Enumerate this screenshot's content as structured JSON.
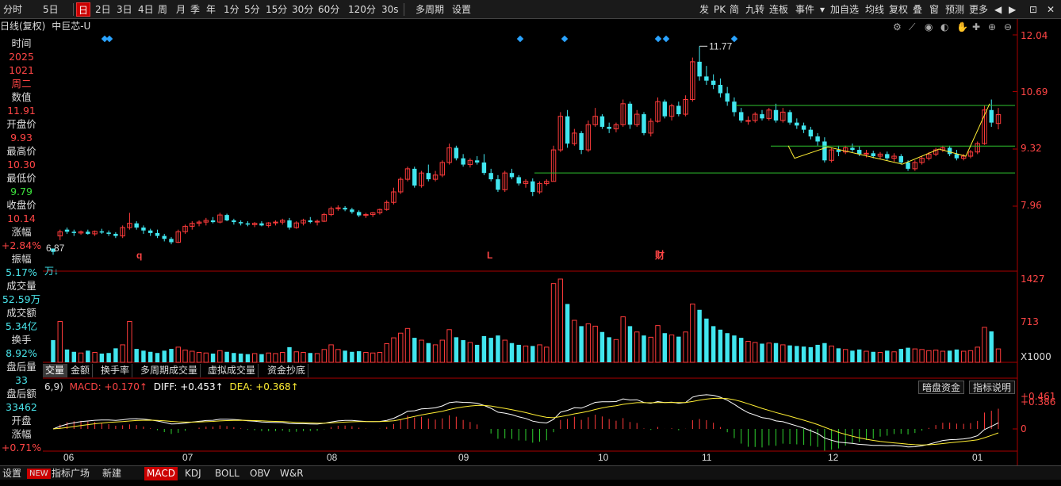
{
  "toolbar": {
    "items": [
      "分时",
      "5日",
      "",
      "日",
      "2日",
      "3日",
      "4日",
      "周",
      "月",
      "季",
      "年",
      "1分",
      "5分",
      "15分",
      "30分",
      "60分",
      "120分",
      "30s",
      "",
      "多周期",
      "设置"
    ],
    "right_items": [
      "发",
      "PK",
      "简",
      "九转",
      "连板",
      "事件",
      "",
      "加自选",
      "均线",
      "复权",
      "叠",
      "窗",
      "预测",
      "更多"
    ]
  },
  "title": {
    "mode": "日线(复权)",
    "stock": "中巨芯-U"
  },
  "left_panel": [
    {
      "label": "时间",
      "value": "2025"
    },
    {
      "label": "",
      "value": "1021"
    },
    {
      "label": "",
      "value": "周二"
    },
    {
      "label": "数值",
      "value": "11.91"
    },
    {
      "label": "开盘价",
      "value": "9.93"
    },
    {
      "label": "最高价",
      "value": "10.30"
    },
    {
      "label": "最低价",
      "value": "9.79"
    },
    {
      "label": "收盘价",
      "value": "10.14"
    },
    {
      "label": "涨幅",
      "value": "+2.84%"
    },
    {
      "label": "振幅",
      "value": "5.17%"
    },
    {
      "label": "成交量",
      "value": "52.59万"
    },
    {
      "label": "成交额",
      "value": "5.34亿"
    },
    {
      "label": "换手",
      "value": "8.92%"
    },
    {
      "label": "盘后量",
      "value": "33"
    },
    {
      "label": "盘后额",
      "value": "33462"
    },
    {
      "label": "开盘",
      "value": ""
    },
    {
      "label": "涨幅",
      "value": "+0.71%"
    }
  ],
  "vol_tabs": [
    "交量",
    "金额",
    "换手率",
    "多周期成交量",
    "虚拟成交量",
    "资金抄底"
  ],
  "macd": {
    "params": "6,9)",
    "macd": "MACD: +0.170↑",
    "diff": "DIFF: +0.453↑",
    "dea": "DEA: +0.368↑",
    "btn1": "暗盘资金",
    "btn2": "指标说明"
  },
  "vol_unit": "万↓",
  "bottom_tabs": [
    "设置",
    "NEW",
    "指标广场",
    "新建",
    "MACD",
    "KDJ",
    "BOLL",
    "OBV",
    "W&R"
  ],
  "chart_data": {
    "type": "candlestick",
    "price_ticks": [
      "12.04",
      "10.69",
      "9.32",
      "7.96"
    ],
    "volume_ticks": [
      "1427",
      "713",
      "X1000"
    ],
    "macd_ticks": [
      "0.461",
      "0.386",
      "0"
    ],
    "x_labels": [
      "06",
      "07",
      "08",
      "09",
      "10",
      "11",
      "12",
      "01"
    ],
    "annotations": {
      "high": "11.77",
      "low": "6.87",
      "markers": [
        "q",
        "L",
        "财"
      ]
    },
    "candles": [
      [
        6.95,
        6.95,
        6.8,
        6.87,
        380
      ],
      [
        7.25,
        7.4,
        7.15,
        7.35,
        700
      ],
      [
        7.4,
        7.45,
        7.3,
        7.35,
        220
      ],
      [
        7.35,
        7.4,
        7.25,
        7.32,
        180
      ],
      [
        7.32,
        7.38,
        7.28,
        7.35,
        160
      ],
      [
        7.35,
        7.4,
        7.28,
        7.3,
        200
      ],
      [
        7.3,
        7.38,
        7.25,
        7.36,
        170
      ],
      [
        7.36,
        7.42,
        7.3,
        7.33,
        150
      ],
      [
        7.33,
        7.38,
        7.25,
        7.3,
        160
      ],
      [
        7.3,
        7.34,
        7.2,
        7.25,
        240
      ],
      [
        7.25,
        7.5,
        7.2,
        7.45,
        300
      ],
      [
        7.45,
        7.8,
        7.4,
        7.55,
        700
      ],
      [
        7.55,
        7.6,
        7.4,
        7.45,
        230
      ],
      [
        7.45,
        7.5,
        7.3,
        7.38,
        200
      ],
      [
        7.38,
        7.42,
        7.25,
        7.32,
        180
      ],
      [
        7.32,
        7.4,
        7.2,
        7.25,
        160
      ],
      [
        7.25,
        7.3,
        7.12,
        7.18,
        200
      ],
      [
        7.18,
        7.22,
        7.05,
        7.1,
        230
      ],
      [
        7.1,
        7.4,
        7.08,
        7.35,
        260
      ],
      [
        7.35,
        7.52,
        7.3,
        7.48,
        210
      ],
      [
        7.48,
        7.6,
        7.4,
        7.55,
        190
      ],
      [
        7.55,
        7.62,
        7.48,
        7.58,
        170
      ],
      [
        7.58,
        7.68,
        7.5,
        7.62,
        160
      ],
      [
        7.62,
        7.7,
        7.55,
        7.58,
        150
      ],
      [
        7.58,
        7.8,
        7.55,
        7.75,
        200
      ],
      [
        7.75,
        7.78,
        7.6,
        7.62,
        180
      ],
      [
        7.62,
        7.66,
        7.52,
        7.58,
        160
      ],
      [
        7.58,
        7.62,
        7.5,
        7.55,
        150
      ],
      [
        7.55,
        7.6,
        7.48,
        7.52,
        140
      ],
      [
        7.52,
        7.58,
        7.46,
        7.55,
        150
      ],
      [
        7.55,
        7.6,
        7.48,
        7.5,
        140
      ],
      [
        7.5,
        7.58,
        7.45,
        7.56,
        160
      ],
      [
        7.56,
        7.62,
        7.5,
        7.58,
        150
      ],
      [
        7.58,
        7.66,
        7.52,
        7.62,
        170
      ],
      [
        7.62,
        7.68,
        7.4,
        7.45,
        260
      ],
      [
        7.45,
        7.6,
        7.42,
        7.56,
        180
      ],
      [
        7.56,
        7.66,
        7.5,
        7.62,
        170
      ],
      [
        7.62,
        7.7,
        7.55,
        7.58,
        160
      ],
      [
        7.58,
        7.64,
        7.5,
        7.6,
        150
      ],
      [
        7.6,
        7.8,
        7.58,
        7.76,
        220
      ],
      [
        7.76,
        7.95,
        7.72,
        7.9,
        300
      ],
      [
        7.9,
        7.98,
        7.85,
        7.92,
        220
      ],
      [
        7.92,
        7.96,
        7.84,
        7.88,
        200
      ],
      [
        7.88,
        7.92,
        7.78,
        7.82,
        180
      ],
      [
        7.82,
        7.86,
        7.7,
        7.74,
        190
      ],
      [
        7.74,
        7.8,
        7.68,
        7.76,
        170
      ],
      [
        7.76,
        7.82,
        7.7,
        7.8,
        160
      ],
      [
        7.8,
        7.9,
        7.76,
        7.88,
        170
      ],
      [
        7.88,
        8.1,
        7.85,
        8.05,
        320
      ],
      [
        8.05,
        8.4,
        8.0,
        8.3,
        420
      ],
      [
        8.3,
        8.65,
        8.25,
        8.6,
        500
      ],
      [
        8.6,
        8.9,
        8.55,
        8.85,
        580
      ],
      [
        8.85,
        8.9,
        8.4,
        8.45,
        420
      ],
      [
        8.45,
        8.8,
        8.4,
        8.75,
        380
      ],
      [
        8.75,
        8.95,
        8.55,
        8.6,
        330
      ],
      [
        8.6,
        8.8,
        8.55,
        8.7,
        300
      ],
      [
        8.7,
        9.05,
        8.65,
        9.0,
        380
      ],
      [
        9.0,
        9.45,
        8.95,
        9.35,
        560
      ],
      [
        9.35,
        9.4,
        9.05,
        9.1,
        430
      ],
      [
        9.1,
        9.2,
        8.9,
        8.95,
        380
      ],
      [
        8.95,
        9.1,
        8.88,
        9.05,
        340
      ],
      [
        9.05,
        9.15,
        8.95,
        9.0,
        300
      ],
      [
        9.0,
        9.2,
        8.7,
        8.75,
        450
      ],
      [
        8.75,
        8.85,
        8.55,
        8.6,
        420
      ],
      [
        8.6,
        8.7,
        8.3,
        8.35,
        460
      ],
      [
        8.35,
        8.8,
        8.3,
        8.75,
        380
      ],
      [
        8.75,
        8.85,
        8.6,
        8.65,
        330
      ],
      [
        8.65,
        8.7,
        8.45,
        8.5,
        300
      ],
      [
        8.5,
        8.6,
        8.4,
        8.55,
        280
      ],
      [
        8.55,
        8.62,
        8.2,
        8.3,
        280
      ],
      [
        8.3,
        8.55,
        8.25,
        8.5,
        300
      ],
      [
        8.5,
        8.6,
        8.45,
        8.55,
        260
      ],
      [
        8.55,
        9.4,
        8.55,
        9.3,
        1350
      ],
      [
        9.3,
        10.2,
        9.25,
        10.1,
        1427
      ],
      [
        10.1,
        10.25,
        9.35,
        9.45,
        1000
      ],
      [
        9.45,
        9.8,
        9.4,
        9.7,
        720
      ],
      [
        9.7,
        9.75,
        9.2,
        9.3,
        620
      ],
      [
        9.3,
        10.0,
        9.25,
        9.9,
        660
      ],
      [
        9.9,
        10.3,
        9.85,
        10.1,
        620
      ],
      [
        10.1,
        10.15,
        9.8,
        9.85,
        520
      ],
      [
        9.85,
        9.95,
        9.7,
        9.8,
        430
      ],
      [
        9.8,
        9.95,
        9.72,
        9.9,
        390
      ],
      [
        9.9,
        10.5,
        9.85,
        10.4,
        780
      ],
      [
        10.4,
        10.45,
        9.8,
        9.9,
        620
      ],
      [
        9.9,
        10.25,
        9.85,
        10.15,
        520
      ],
      [
        10.15,
        10.2,
        9.65,
        9.7,
        460
      ],
      [
        9.7,
        10.05,
        9.62,
        9.98,
        430
      ],
      [
        9.98,
        10.55,
        9.95,
        10.45,
        630
      ],
      [
        10.45,
        10.5,
        10.05,
        10.1,
        500
      ],
      [
        10.1,
        10.4,
        10.0,
        10.35,
        470
      ],
      [
        10.35,
        10.45,
        10.1,
        10.15,
        440
      ],
      [
        10.15,
        10.6,
        10.1,
        10.5,
        520
      ],
      [
        10.5,
        11.5,
        10.45,
        11.4,
        1000
      ],
      [
        11.4,
        11.77,
        10.95,
        11.05,
        900
      ],
      [
        11.05,
        11.3,
        10.85,
        10.95,
        750
      ],
      [
        10.95,
        11.1,
        10.75,
        10.85,
        620
      ],
      [
        10.85,
        11.0,
        10.55,
        10.65,
        560
      ],
      [
        10.65,
        10.8,
        10.35,
        10.45,
        500
      ],
      [
        10.45,
        10.55,
        10.1,
        10.2,
        460
      ],
      [
        10.2,
        10.3,
        9.95,
        10.0,
        420
      ],
      [
        10.0,
        10.1,
        9.9,
        10.0,
        360
      ],
      [
        10.0,
        10.2,
        9.95,
        10.15,
        340
      ],
      [
        10.15,
        10.25,
        10.0,
        10.05,
        320
      ],
      [
        10.05,
        10.3,
        10.0,
        10.25,
        330
      ],
      [
        10.25,
        10.4,
        9.95,
        10.0,
        330
      ],
      [
        10.0,
        10.3,
        9.95,
        10.2,
        300
      ],
      [
        10.2,
        10.25,
        9.9,
        9.95,
        290
      ],
      [
        9.95,
        10.05,
        9.8,
        9.88,
        280
      ],
      [
        9.88,
        9.95,
        9.7,
        9.78,
        270
      ],
      [
        9.78,
        9.85,
        9.55,
        9.62,
        260
      ],
      [
        9.62,
        9.7,
        9.4,
        9.5,
        300
      ],
      [
        9.5,
        9.6,
        9.0,
        9.05,
        330
      ],
      [
        9.05,
        9.35,
        9.0,
        9.3,
        280
      ],
      [
        9.3,
        9.4,
        9.15,
        9.25,
        240
      ],
      [
        9.25,
        9.4,
        9.2,
        9.35,
        220
      ],
      [
        9.35,
        9.45,
        9.25,
        9.3,
        200
      ],
      [
        9.3,
        9.38,
        9.15,
        9.2,
        220
      ],
      [
        9.2,
        9.3,
        9.12,
        9.22,
        190
      ],
      [
        9.22,
        9.28,
        9.1,
        9.15,
        180
      ],
      [
        9.15,
        9.25,
        9.08,
        9.2,
        170
      ],
      [
        9.2,
        9.26,
        9.05,
        9.1,
        200
      ],
      [
        9.1,
        9.22,
        9.02,
        9.15,
        180
      ],
      [
        9.15,
        9.2,
        8.95,
        9.0,
        230
      ],
      [
        9.0,
        9.05,
        8.8,
        8.85,
        250
      ],
      [
        8.85,
        9.05,
        8.8,
        9.0,
        230
      ],
      [
        9.0,
        9.15,
        8.95,
        9.1,
        220
      ],
      [
        9.1,
        9.25,
        9.05,
        9.2,
        200
      ],
      [
        9.2,
        9.35,
        9.15,
        9.3,
        210
      ],
      [
        9.3,
        9.4,
        9.25,
        9.35,
        190
      ],
      [
        9.35,
        9.4,
        9.15,
        9.2,
        200
      ],
      [
        9.2,
        9.3,
        9.05,
        9.1,
        220
      ],
      [
        9.1,
        9.2,
        9.05,
        9.15,
        190
      ],
      [
        9.15,
        9.3,
        9.1,
        9.25,
        200
      ],
      [
        9.25,
        9.5,
        9.2,
        9.45,
        260
      ],
      [
        9.45,
        10.35,
        9.42,
        10.25,
        600
      ],
      [
        10.25,
        10.5,
        9.85,
        9.95,
        530
      ],
      [
        9.93,
        10.3,
        9.79,
        10.14,
        230
      ]
    ]
  }
}
